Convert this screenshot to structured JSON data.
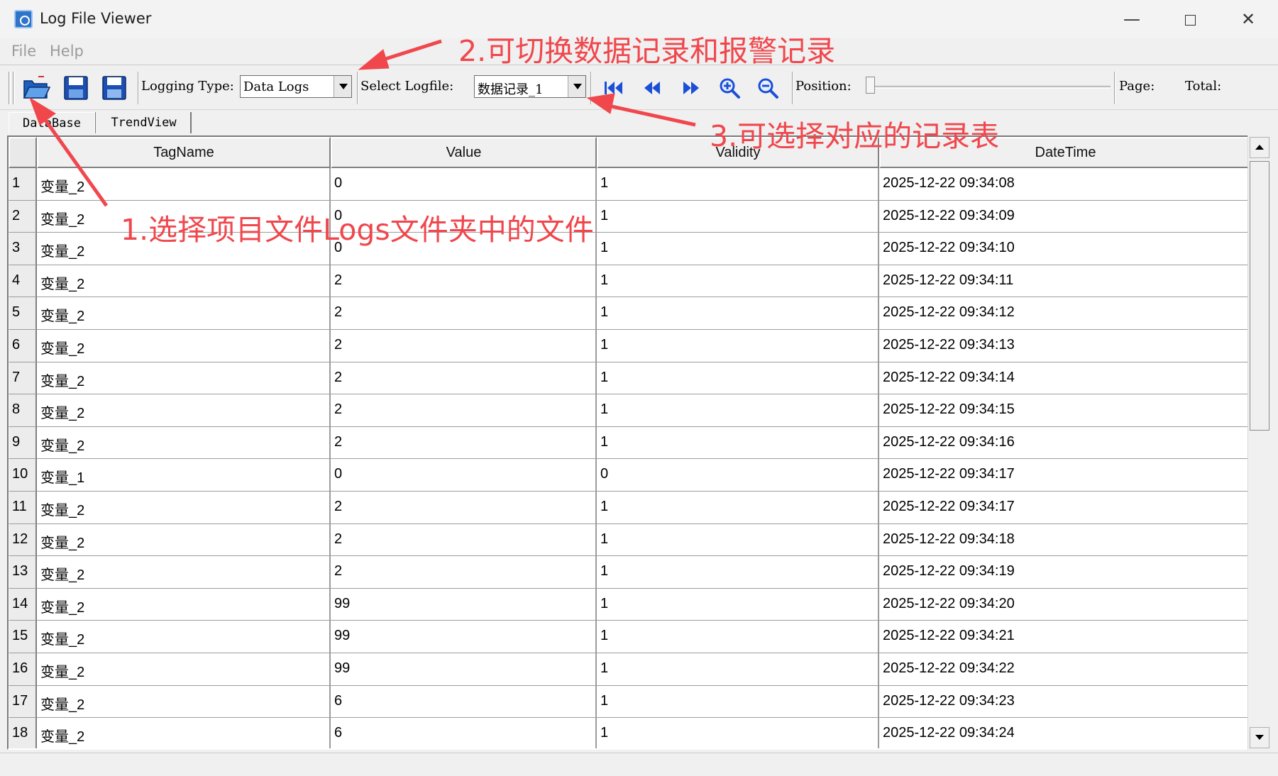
{
  "window": {
    "title": "Log File Viewer",
    "minimize_glyph": "—",
    "close_glyph": "✕"
  },
  "menu": [
    "File",
    "Help"
  ],
  "toolbar": {
    "logging_type_label": "Logging Type:",
    "logging_type_value": "Data Logs",
    "select_logfile_label": "Select Logfile:",
    "select_logfile_value": "数据记录_1",
    "position_label": "Position:",
    "position_value": 0,
    "page_label": "Page:",
    "total_label": "Total:"
  },
  "tabs": [
    "DataBase",
    "TrendView"
  ],
  "table": {
    "columns": [
      "TagName",
      "Value",
      "Validity",
      "DateTime"
    ],
    "rows": [
      {
        "num": "1",
        "tag": "变量_2",
        "value": "0",
        "validity": "1",
        "datetime": "2025-12-22 09:34:08"
      },
      {
        "num": "2",
        "tag": "变量_2",
        "value": "0",
        "validity": "1",
        "datetime": "2025-12-22 09:34:09"
      },
      {
        "num": "3",
        "tag": "变量_2",
        "value": "0",
        "validity": "1",
        "datetime": "2025-12-22 09:34:10"
      },
      {
        "num": "4",
        "tag": "变量_2",
        "value": "2",
        "validity": "1",
        "datetime": "2025-12-22 09:34:11"
      },
      {
        "num": "5",
        "tag": "变量_2",
        "value": "2",
        "validity": "1",
        "datetime": "2025-12-22 09:34:12"
      },
      {
        "num": "6",
        "tag": "变量_2",
        "value": "2",
        "validity": "1",
        "datetime": "2025-12-22 09:34:13"
      },
      {
        "num": "7",
        "tag": "变量_2",
        "value": "2",
        "validity": "1",
        "datetime": "2025-12-22 09:34:14"
      },
      {
        "num": "8",
        "tag": "变量_2",
        "value": "2",
        "validity": "1",
        "datetime": "2025-12-22 09:34:15"
      },
      {
        "num": "9",
        "tag": "变量_2",
        "value": "2",
        "validity": "1",
        "datetime": "2025-12-22 09:34:16"
      },
      {
        "num": "10",
        "tag": "变量_1",
        "value": "0",
        "validity": "0",
        "datetime": "2025-12-22 09:34:17"
      },
      {
        "num": "11",
        "tag": "变量_2",
        "value": "2",
        "validity": "1",
        "datetime": "2025-12-22 09:34:17"
      },
      {
        "num": "12",
        "tag": "变量_2",
        "value": "2",
        "validity": "1",
        "datetime": "2025-12-22 09:34:18"
      },
      {
        "num": "13",
        "tag": "变量_2",
        "value": "2",
        "validity": "1",
        "datetime": "2025-12-22 09:34:19"
      },
      {
        "num": "14",
        "tag": "变量_2",
        "value": "99",
        "validity": "1",
        "datetime": "2025-12-22 09:34:20"
      },
      {
        "num": "15",
        "tag": "变量_2",
        "value": "99",
        "validity": "1",
        "datetime": "2025-12-22 09:34:21"
      },
      {
        "num": "16",
        "tag": "变量_2",
        "value": "99",
        "validity": "1",
        "datetime": "2025-12-22 09:34:22"
      },
      {
        "num": "17",
        "tag": "变量_2",
        "value": "6",
        "validity": "1",
        "datetime": "2025-12-22 09:34:23"
      },
      {
        "num": "18",
        "tag": "变量_2",
        "value": "6",
        "validity": "1",
        "datetime": "2025-12-22 09:34:24"
      }
    ]
  },
  "annotations": {
    "note1": "1.选择项目文件Logs文件夹中的文件",
    "note2": "2.可切换数据记录和报警记录",
    "note3": "3.可选择对应的记录表",
    "color": "#f0474d"
  },
  "icons": {
    "toolbar": [
      "open-folder-icon",
      "save-icon",
      "save-as-icon",
      "first-page-icon",
      "rewind-icon",
      "fast-forward-icon",
      "zoom-in-icon",
      "zoom-out-icon"
    ]
  }
}
